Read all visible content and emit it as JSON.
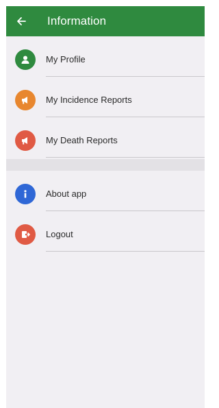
{
  "appbar": {
    "title": "Information",
    "back_icon": "arrow-left-icon",
    "color": "#2f8a3f"
  },
  "menu": {
    "items": [
      {
        "label": "My Profile",
        "icon": "person-icon",
        "color": "#2f8a3f"
      },
      {
        "label": "My Incidence Reports",
        "icon": "megaphone-icon",
        "color": "#e8872f"
      },
      {
        "label": "My Death Reports",
        "icon": "megaphone-icon",
        "color": "#e05a44"
      }
    ],
    "secondary_items": [
      {
        "label": "About app",
        "icon": "info-icon",
        "color": "#2f67d6"
      },
      {
        "label": "Logout",
        "icon": "logout-icon",
        "color": "#e05a44"
      }
    ]
  }
}
